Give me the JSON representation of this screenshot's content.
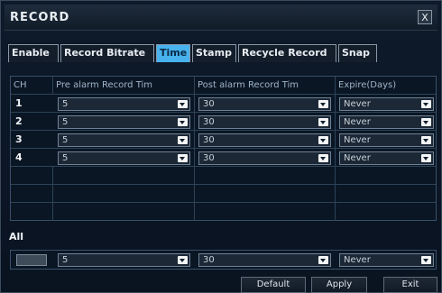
{
  "window": {
    "title": "RECORD",
    "close_symbol": "X"
  },
  "tabs": [
    {
      "label": "Enable",
      "active": false
    },
    {
      "label": "Record Bitrate",
      "active": false
    },
    {
      "label": "Time",
      "active": true
    },
    {
      "label": "Stamp",
      "active": false
    },
    {
      "label": "Recycle Record",
      "active": false
    },
    {
      "label": "Snap",
      "active": false
    }
  ],
  "table": {
    "headers": [
      "CH",
      "Pre alarm Record Tim",
      "Post alarm Record Tim",
      "Expire(Days)"
    ],
    "rows": [
      {
        "ch": "1",
        "pre": "5",
        "post": "30",
        "expire": "Never"
      },
      {
        "ch": "2",
        "pre": "5",
        "post": "30",
        "expire": "Never"
      },
      {
        "ch": "3",
        "pre": "5",
        "post": "30",
        "expire": "Never"
      },
      {
        "ch": "4",
        "pre": "5",
        "post": "30",
        "expire": "Never"
      }
    ]
  },
  "all": {
    "label": "All",
    "pre": "5",
    "post": "30",
    "expire": "Never"
  },
  "footer": {
    "default_label": "Default",
    "apply_label": "Apply",
    "exit_label": "Exit"
  },
  "colors": {
    "active_tab": "#47b2ee",
    "background": "#0a1320"
  }
}
